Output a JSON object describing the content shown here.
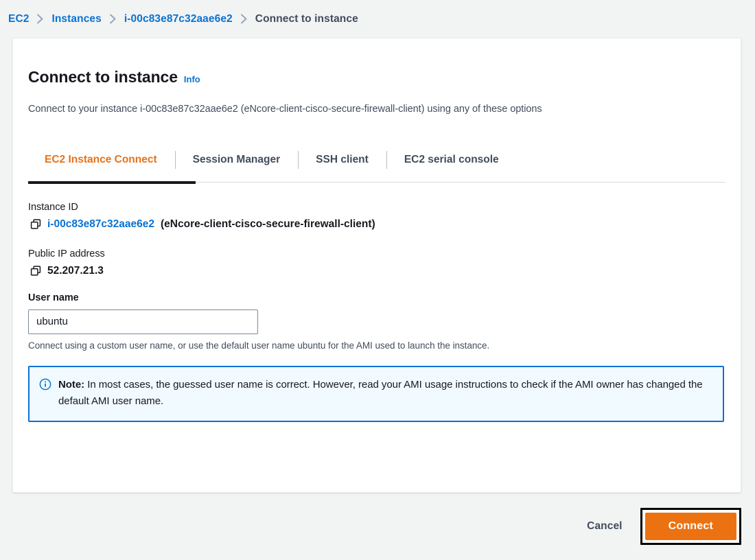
{
  "breadcrumb": {
    "items": [
      {
        "label": "EC2",
        "current": false
      },
      {
        "label": "Instances",
        "current": false
      },
      {
        "label": "i-00c83e87c32aae6e2",
        "current": false
      },
      {
        "label": "Connect to instance",
        "current": true
      }
    ],
    "separator_icon": "chevron-right-icon"
  },
  "header": {
    "title": "Connect to instance",
    "info_label": "Info",
    "subtitle": "Connect to your instance i-00c83e87c32aae6e2 (eNcore-client-cisco-secure-firewall-client) using any of these options"
  },
  "tabs": {
    "items": [
      {
        "label": "EC2 Instance Connect",
        "active": true
      },
      {
        "label": "Session Manager",
        "active": false
      },
      {
        "label": "SSH client",
        "active": false
      },
      {
        "label": "EC2 serial console",
        "active": false
      }
    ]
  },
  "instance": {
    "id_label": "Instance ID",
    "id_value": "i-00c83e87c32aae6e2",
    "id_name_suffix": "(eNcore-client-cisco-secure-firewall-client)",
    "ip_label": "Public IP address",
    "ip_value": "52.207.21.3",
    "copy_icon": "copy-icon"
  },
  "user_name": {
    "label": "User name",
    "value": "ubuntu",
    "placeholder": "",
    "help_text": "Connect using a custom user name, or use the default user name ubuntu for the AMI used to launch the instance."
  },
  "alert": {
    "icon": "info-circle-icon",
    "title": "Note:",
    "body": " In most cases, the guessed user name is correct. However, read your AMI usage instructions to check if the AMI owner has changed the default AMI user name."
  },
  "footer": {
    "cancel_label": "Cancel",
    "connect_label": "Connect"
  },
  "colors": {
    "accent_orange": "#ec7211",
    "active_tab_text": "#e7721a",
    "link_blue": "#0972d3",
    "alert_border": "#0972d3",
    "alert_background": "#f1faff",
    "page_background": "#f2f3f3",
    "text_dark": "#16191f",
    "text_slate": "#414d5c",
    "focus_ring": "#000000"
  }
}
